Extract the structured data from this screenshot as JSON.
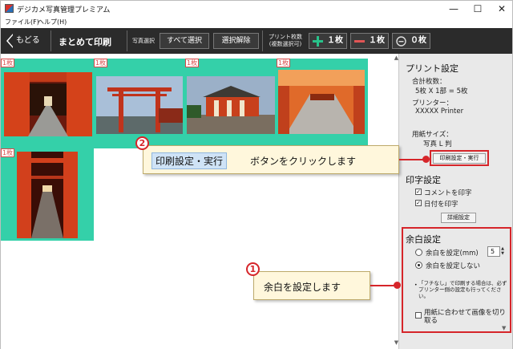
{
  "window": {
    "title": "デジカメ写真管理プレミアム",
    "controls": {
      "minimize": "—",
      "maximize": "☐",
      "close": "✕"
    }
  },
  "menu": [
    "ファイル(F)",
    "ヘルプ(H)"
  ],
  "toolbar": {
    "back_label": "もどる",
    "title": "まとめて印刷",
    "photo_select_label": "写真選択",
    "select_all_label": "すべて選択",
    "deselect_label": "選択解除",
    "print_count_label": "プリント枚数",
    "print_count_sub": "(複数選択可)",
    "plus_label": "１枚",
    "minus_label": "１枚",
    "zero_label": "０枚"
  },
  "thumbnails": [
    {
      "badge": "1枚"
    },
    {
      "badge": "1枚"
    },
    {
      "badge": "1枚"
    },
    {
      "badge": "1枚"
    },
    {
      "badge": "1枚"
    }
  ],
  "panel": {
    "print_settings_heading": "プリント設定",
    "total_label": "合計枚数：",
    "total_value": "5枚 X 1部 = 5枚",
    "printer_label": "プリンター：",
    "printer_value": "XXXXX Printer",
    "paper_label": "用紙サイズ：",
    "paper_value": "写真 L 判",
    "print_setup_button": "印刷設定・実行",
    "text_print_heading": "印字設定",
    "print_comment": "コメントを印字",
    "print_date": "日付を印字",
    "detail_button": "詳細設定",
    "margin_heading": "余白設定",
    "margin_set": "余白を設定(mm)",
    "margin_value": "5",
    "margin_none": "余白を設定しない",
    "note": "「フチなし」で印刷する場合は、必ずプリンター側の設定も行ってください。",
    "fit_paper": "用紙に合わせて画像を切り取る"
  },
  "callouts": {
    "one_num": "1",
    "one_text": "余白を設定します",
    "two_num": "2",
    "two_highlight": "印刷設定・実行",
    "two_text": "ボタンをクリックします"
  },
  "colors": {
    "accent_red": "#d6252a",
    "toolbar_bg": "#2b2b2b",
    "selection_green": "#34d0a9",
    "panel_bg": "#e9e9e9",
    "callout_bg": "#fff7dc"
  }
}
